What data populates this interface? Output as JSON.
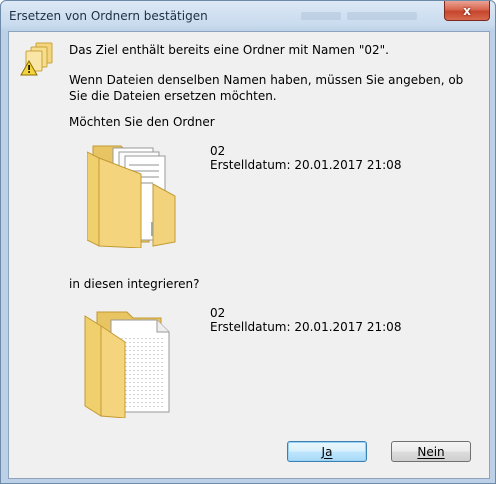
{
  "window": {
    "title": "Ersetzen von Ordnern bestätigen",
    "close_glyph": "x"
  },
  "message": {
    "line1": "Das Ziel enthält bereits eine Ordner mit Namen \"02\".",
    "line2": "Wenn Dateien denselben Namen haben, müssen Sie angeben, ob Sie die Dateien ersetzen möchten.",
    "line3": "Möchten Sie den Ordner",
    "line4": "in diesen integrieren?"
  },
  "source_folder": {
    "name": "02",
    "created": "Erstelldatum: 20.01.2017 21:08",
    "icon": "folder-with-documents-icon"
  },
  "target_folder": {
    "name": "02",
    "created": "Erstelldatum: 20.01.2017 21:08",
    "icon": "folder-with-page-icon"
  },
  "buttons": {
    "yes_label": "Ja",
    "no_label": "Nein"
  },
  "colors": {
    "accent_button_border": "#3c7fb1",
    "close_button": "#c5452c",
    "folder_yellow": "#f2d27a"
  }
}
